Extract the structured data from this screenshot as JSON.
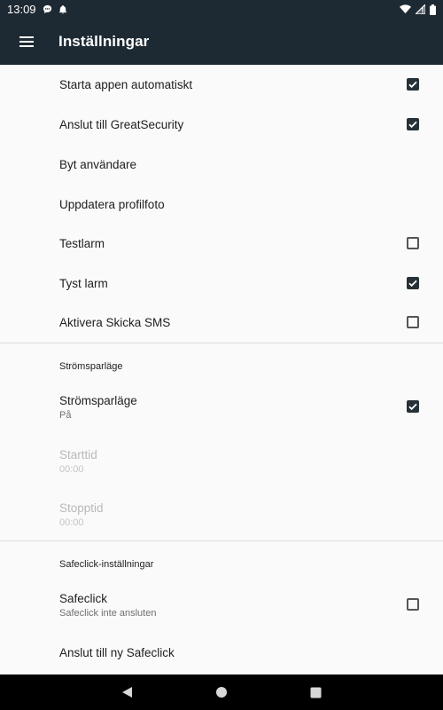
{
  "status_bar": {
    "time": "13:09",
    "left_icons": [
      "chat-bubble-icon",
      "alarm-bell-icon"
    ],
    "right_icons": [
      "wifi-icon",
      "signal-icon",
      "battery-icon"
    ]
  },
  "app_bar": {
    "title": "Inställningar",
    "menu_icon": "hamburger-menu-icon",
    "background": "#1e2a33"
  },
  "settings": {
    "general": [
      {
        "title": "Starta appen automatiskt",
        "checkbox": true,
        "checked": true
      },
      {
        "title": "Anslut till GreatSecurity",
        "checkbox": true,
        "checked": true
      },
      {
        "title": "Byt användare",
        "checkbox": false
      },
      {
        "title": "Uppdatera profilfoto",
        "checkbox": false
      },
      {
        "title": "Testlarm",
        "checkbox": true,
        "checked": false
      },
      {
        "title": "Tyst larm",
        "checkbox": true,
        "checked": true
      },
      {
        "title": "Aktivera Skicka SMS",
        "checkbox": true,
        "checked": false
      }
    ],
    "power_saving": {
      "category": "Strömsparläge",
      "items": [
        {
          "title": "Strömsparläge",
          "summary": "På",
          "checkbox": true,
          "checked": true,
          "enabled": true
        },
        {
          "title": "Starttid",
          "summary": "00:00",
          "checkbox": false,
          "enabled": false
        },
        {
          "title": "Stopptid",
          "summary": "00:00",
          "checkbox": false,
          "enabled": false
        }
      ]
    },
    "safeclick": {
      "category": "Safeclick-inställningar",
      "items": [
        {
          "title": "Safeclick",
          "summary": "Safeclick inte ansluten",
          "checkbox": true,
          "checked": false,
          "enabled": true
        },
        {
          "title": "Anslut till ny Safeclick",
          "checkbox": false,
          "enabled": true
        }
      ]
    }
  },
  "nav_bar": {
    "buttons": [
      "back-triangle-icon",
      "home-circle-icon",
      "recents-square-icon"
    ]
  },
  "colors": {
    "accent": "#263238",
    "background": "#fafafa",
    "divider": "#dcdcdc"
  }
}
